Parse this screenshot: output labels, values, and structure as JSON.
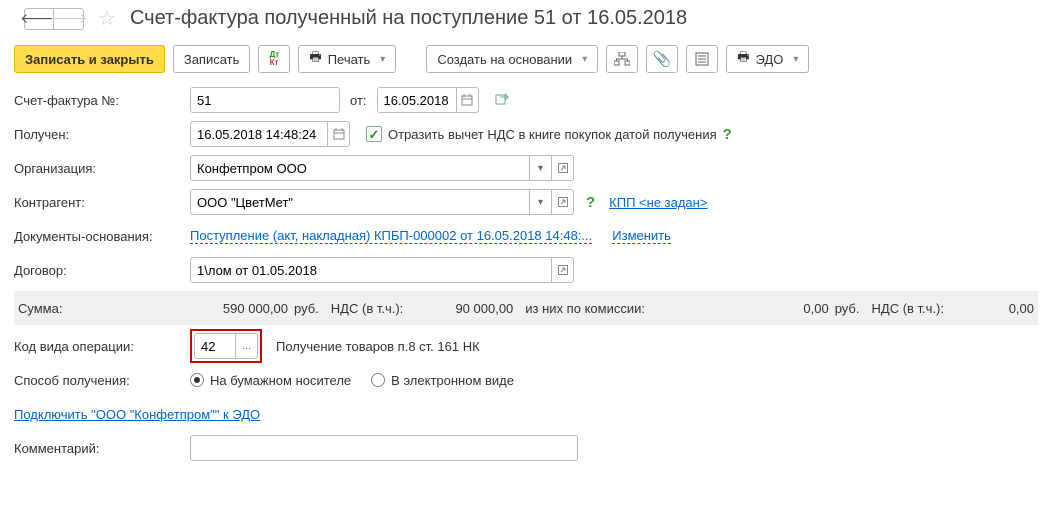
{
  "header": {
    "title": "Счет-фактура полученный на поступление 51 от 16.05.2018"
  },
  "toolbar": {
    "write_close": "Записать и закрыть",
    "write": "Записать",
    "print": "Печать",
    "create_based": "Создать на основании",
    "edo": "ЭДО"
  },
  "form": {
    "invoice_no_label": "Счет-фактура №:",
    "invoice_no": "51",
    "from_label": "от:",
    "invoice_date": "16.05.2018",
    "received_label": "Получен:",
    "received_datetime": "16.05.2018 14:48:24",
    "vat_checkbox_label": "Отразить вычет НДС в книге покупок датой получения",
    "org_label": "Организация:",
    "org_value": "Конфетпром ООО",
    "counterparty_label": "Контрагент:",
    "counterparty_value": "ООО \"ЦветМет\"",
    "kpp_not_set": "КПП <не задан>",
    "basis_docs_label": "Документы-основания:",
    "basis_doc_link": "Поступление (акт, накладная) КПБП-000002 от 16.05.2018 14:48:...",
    "change_link": "Изменить",
    "contract_label": "Договор:",
    "contract_value": "1\\лом от 01.05.2018",
    "op_code_label": "Код вида операции:",
    "op_code_value": "42",
    "op_code_desc": "Получение товаров п.8 ст. 161 НК",
    "receive_method_label": "Способ получения:",
    "receive_paper": "На бумажном носителе",
    "receive_electronic": "В электронном виде",
    "connect_edo_link": "Подключить \"ООО \"Конфетпром\"\" к ЭДО",
    "comment_label": "Комментарий:",
    "comment_value": ""
  },
  "summary": {
    "sum_label": "Сумма:",
    "sum_value": "590 000,00",
    "rub": "руб.",
    "vat_incl": "НДС (в т.ч.):",
    "vat_value": "90 000,00",
    "commission_label": "из них по комиссии:",
    "commission_value": "0,00",
    "vat2_label": "НДС (в т.ч.):",
    "vat2_value": "0,00"
  }
}
